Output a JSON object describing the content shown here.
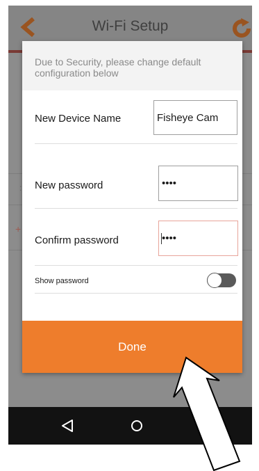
{
  "header": {
    "title": "Wi-Fi Setup",
    "back_icon": "chevron-left-icon",
    "refresh_icon": "refresh-icon",
    "accent_color": "#ee7d2c"
  },
  "dialog": {
    "notice": "Due to Security, please change default configuration below",
    "device_name": {
      "label": "New Device Name",
      "value": "Fisheye Cam"
    },
    "new_password": {
      "label": "New password",
      "value": "••••"
    },
    "confirm_password": {
      "label": "Confirm password",
      "value": "••••"
    },
    "show_password": {
      "label": "Show password",
      "enabled": false
    },
    "done_label": "Done"
  },
  "navbar": {
    "back_icon": "triangle-back-icon",
    "home_icon": "circle-home-icon"
  },
  "annotation": {
    "icon": "pointer-arrow-icon"
  }
}
